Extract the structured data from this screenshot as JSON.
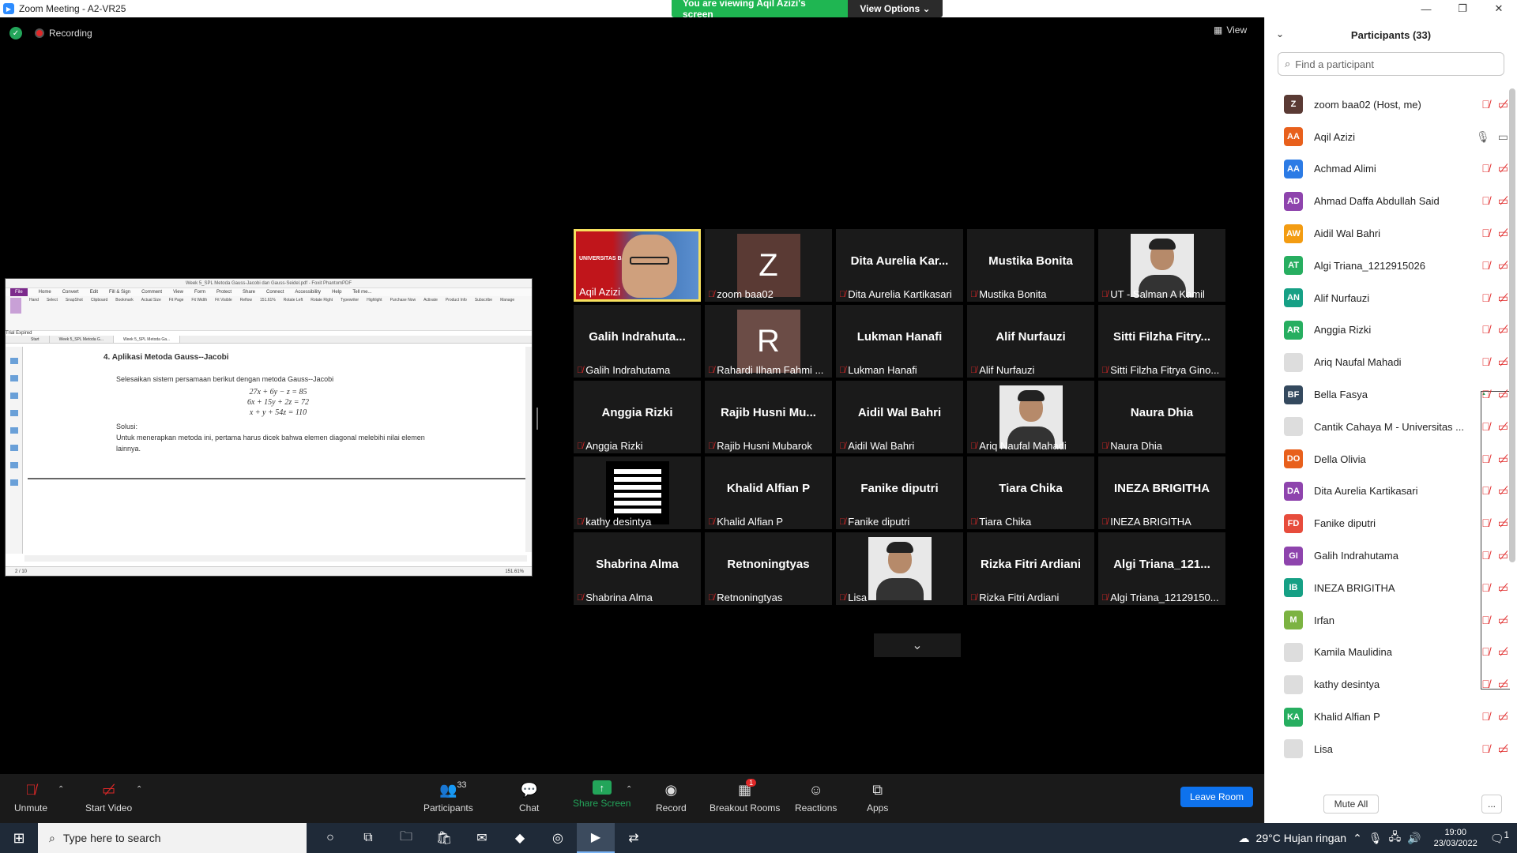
{
  "window": {
    "title": "Zoom Meeting - A2-VR25",
    "controls": [
      "—",
      "❐",
      "✕"
    ]
  },
  "banner": {
    "viewing": "You are viewing Aqil Azizi's screen",
    "view_options": "View Options"
  },
  "topbar": {
    "recording": "Recording",
    "view": "View"
  },
  "shared_screen": {
    "title": "Week 5_SPL Metoda Gauss-Jacobi dan Gauss-Seidel.pdf - Foxit PhantomPDF",
    "menu": [
      "File",
      "Home",
      "Convert",
      "Edit",
      "Fill & Sign",
      "Comment",
      "View",
      "Form",
      "Protect",
      "Share",
      "Connect",
      "Accessibility",
      "Help",
      "Tell me..."
    ],
    "ribbon": [
      "Hand",
      "Select",
      "SnapShot",
      "Clipboard",
      "Bookmark",
      "Actual Size",
      "Fit Page",
      "Fit Width",
      "Fit Visible",
      "Reflow",
      "151.61%",
      "Rotate Left",
      "Rotate Right",
      "Typewriter",
      "Highlight",
      "Purchase Now",
      "Activate",
      "Product Info",
      "Subscribe",
      "Manage"
    ],
    "trial": "Trial Expired",
    "tabs": [
      "Start",
      "Week 5_SPL Metoda G...",
      "Week 5_SPL Metoda Ga..."
    ],
    "heading": "4.   Aplikasi Metoda Gauss--Jacobi",
    "intro": "Selesaikan sistem persamaan berikut dengan metoda Gauss--Jacobi",
    "equations": [
      "27x + 6y − z = 85",
      "6x + 15y + 2z = 72",
      "x + y + 54z = 110"
    ],
    "solusi": "Solusi:",
    "body": "Untuk menerapkan metoda ini, pertama harus dicek bahwa elemen diagonal melebihi nilai elemen lainnya.",
    "page": "2 / 10",
    "zoom": "151.61%"
  },
  "tiles": [
    {
      "kind": "video",
      "label": "Aqil Azizi",
      "muted": false,
      "video_text": "UNIVERSITAS BAKRIE"
    },
    {
      "kind": "avatar",
      "letter": "Z",
      "color": "#5a3a34",
      "label": "zoom baa02",
      "muted": true
    },
    {
      "kind": "name",
      "big": "Dita Aurelia Kar...",
      "label": "Dita Aurelia Kartikasari",
      "muted": true
    },
    {
      "kind": "name",
      "big": "Mustika Bonita",
      "label": "Mustika Bonita",
      "muted": true
    },
    {
      "kind": "photo",
      "label": "UT - Salman A Kamil",
      "muted": true
    },
    {
      "kind": "name",
      "big": "Galih  Indrahuta...",
      "label": "Galih Indrahutama",
      "muted": true
    },
    {
      "kind": "avatar",
      "letter": "R",
      "color": "#6b4c46",
      "label": "Rahardi Ilham Fahmi ...",
      "muted": true
    },
    {
      "kind": "name",
      "big": "Lukman Hanafi",
      "label": "Lukman Hanafi",
      "muted": true
    },
    {
      "kind": "name",
      "big": "Alif Nurfauzi",
      "label": "Alif Nurfauzi",
      "muted": true
    },
    {
      "kind": "name",
      "big": "Sitti Filzha Fitry...",
      "label": "Sitti Filzha Fitrya Gino...",
      "muted": true
    },
    {
      "kind": "name",
      "big": "Anggia Rizki",
      "label": "Anggia Rizki",
      "muted": true
    },
    {
      "kind": "name",
      "big": "Rajib  Husni  Mu...",
      "label": "Rajib Husni Mubarok",
      "muted": true
    },
    {
      "kind": "name",
      "big": "Aidil Wal Bahri",
      "label": "Aidil Wal Bahri",
      "muted": true
    },
    {
      "kind": "photo",
      "label": "Ariq Naufal Mahadi",
      "muted": true
    },
    {
      "kind": "name",
      "big": "Naura Dhia",
      "label": "Naura Dhia",
      "muted": true
    },
    {
      "kind": "stripes",
      "label": "kathy desintya",
      "muted": true
    },
    {
      "kind": "name",
      "big": "Khalid Alfian P",
      "label": "Khalid Alfian P",
      "muted": true
    },
    {
      "kind": "name",
      "big": "Fanike diputri",
      "label": "Fanike diputri",
      "muted": true
    },
    {
      "kind": "name",
      "big": "Tiara Chika",
      "label": "Tiara Chika",
      "muted": true
    },
    {
      "kind": "name",
      "big": "INEZA BRIGITHA",
      "label": "INEZA BRIGITHA",
      "muted": true
    },
    {
      "kind": "name",
      "big": "Shabrina Alma",
      "label": "Shabrina Alma",
      "muted": true
    },
    {
      "kind": "name",
      "big": "Retnoningtyas",
      "label": "Retnoningtyas",
      "muted": true
    },
    {
      "kind": "photo",
      "label": "Lisa",
      "muted": true
    },
    {
      "kind": "name",
      "big": "Rizka Fitri Ardiani",
      "label": "Rizka Fitri Ardiani",
      "muted": true
    },
    {
      "kind": "name",
      "big": "Algi Triana_121...",
      "label": "Algi Triana_12129150...",
      "muted": true
    }
  ],
  "toolbar": {
    "unmute": "Unmute",
    "start_video": "Start Video",
    "participants": "Participants",
    "participants_count": "33",
    "chat": "Chat",
    "share_screen": "Share Screen",
    "record": "Record",
    "breakout": "Breakout Rooms",
    "breakout_badge": "1",
    "reactions": "Reactions",
    "apps": "Apps",
    "leave": "Leave Room"
  },
  "panel": {
    "title": "Participants (33)",
    "search_placeholder": "Find a participant",
    "mute_all": "Mute All",
    "more": "...",
    "participants": [
      {
        "initials": "Z",
        "color": "#5a3a34",
        "name": "zoom baa02 (Host, me)"
      },
      {
        "initials": "AA",
        "color": "#e8601c",
        "name": "Aqil Azizi",
        "sharing": true
      },
      {
        "initials": "AA",
        "color": "#2c7be5",
        "name": "Achmad Alimi"
      },
      {
        "initials": "AD",
        "color": "#8e44ad",
        "name": "Ahmad Daffa Abdullah Said"
      },
      {
        "initials": "AW",
        "color": "#f39c12",
        "name": "Aidil Wal Bahri"
      },
      {
        "initials": "AT",
        "color": "#27ae60",
        "name": "Algi Triana_1212915026"
      },
      {
        "initials": "AN",
        "color": "#16a085",
        "name": "Alif Nurfauzi"
      },
      {
        "initials": "AR",
        "color": "#27ae60",
        "name": "Anggia Rizki"
      },
      {
        "initials": "",
        "color": "#ddd",
        "name": "Ariq Naufal Mahadi",
        "photo": true
      },
      {
        "initials": "BF",
        "color": "#34495e",
        "name": "Bella Fasya"
      },
      {
        "initials": "",
        "color": "#ddd",
        "name": "Cantik Cahaya M - Universitas ...",
        "photo": true
      },
      {
        "initials": "DO",
        "color": "#e8601c",
        "name": "Della Olivia"
      },
      {
        "initials": "DA",
        "color": "#8e44ad",
        "name": "Dita Aurelia Kartikasari"
      },
      {
        "initials": "FD",
        "color": "#e74c3c",
        "name": "Fanike diputri"
      },
      {
        "initials": "GI",
        "color": "#8e44ad",
        "name": "Galih Indrahutama"
      },
      {
        "initials": "IB",
        "color": "#16a085",
        "name": "INEZA BRIGITHA"
      },
      {
        "initials": "M",
        "color": "#7cb342",
        "name": "Irfan"
      },
      {
        "initials": "",
        "color": "#ddd",
        "name": "Kamila Maulidina",
        "photo": true
      },
      {
        "initials": "",
        "color": "#ddd",
        "name": "kathy desintya",
        "photo": true
      },
      {
        "initials": "KA",
        "color": "#27ae60",
        "name": "Khalid Alfian P"
      },
      {
        "initials": "",
        "color": "#ddd",
        "name": "Lisa",
        "photo": true
      }
    ]
  },
  "taskbar": {
    "search_placeholder": "Type here to search",
    "weather": "29°C  Hujan ringan",
    "time": "19:00",
    "date": "23/03/2022",
    "notifications": "1"
  }
}
